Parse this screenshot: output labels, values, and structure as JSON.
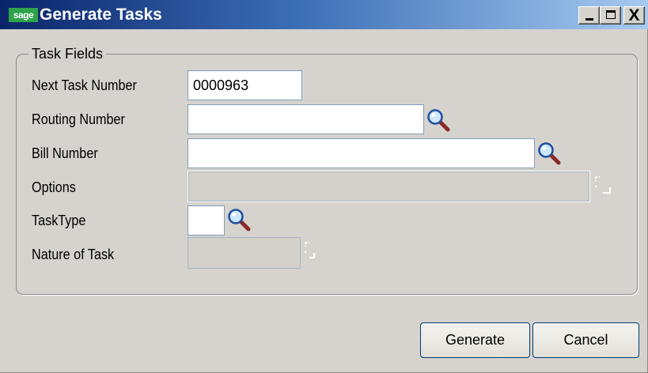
{
  "window": {
    "logo_text": "sage",
    "title": "Generate Tasks",
    "controls": {
      "minimize": "_",
      "maximize": "□",
      "close": "X"
    }
  },
  "group": {
    "label": "Task Fields"
  },
  "fields": {
    "next_task_number": {
      "label": "Next Task Number",
      "value": "0000963"
    },
    "routing_number": {
      "label": "Routing Number",
      "value": ""
    },
    "bill_number": {
      "label": "Bill Number",
      "value": ""
    },
    "options": {
      "label": "Options",
      "value": ""
    },
    "task_type": {
      "label": "TaskType",
      "value": ""
    },
    "nature_of_task": {
      "label": "Nature of Task",
      "value": ""
    }
  },
  "buttons": {
    "generate": {
      "mnemonic": "G",
      "rest": "enerate"
    },
    "cancel": {
      "mnemonic": "C",
      "rest": "ancel"
    }
  },
  "icons": {
    "lookup": "magnifier-icon",
    "expand": "dotted-corner-icon"
  },
  "colors": {
    "titlebar_start": "#0a246a",
    "titlebar_end": "#a6caf0",
    "dialog_bg": "#d6d3ce",
    "button_border": "#003c74",
    "sage_green": "#2fa34a"
  }
}
